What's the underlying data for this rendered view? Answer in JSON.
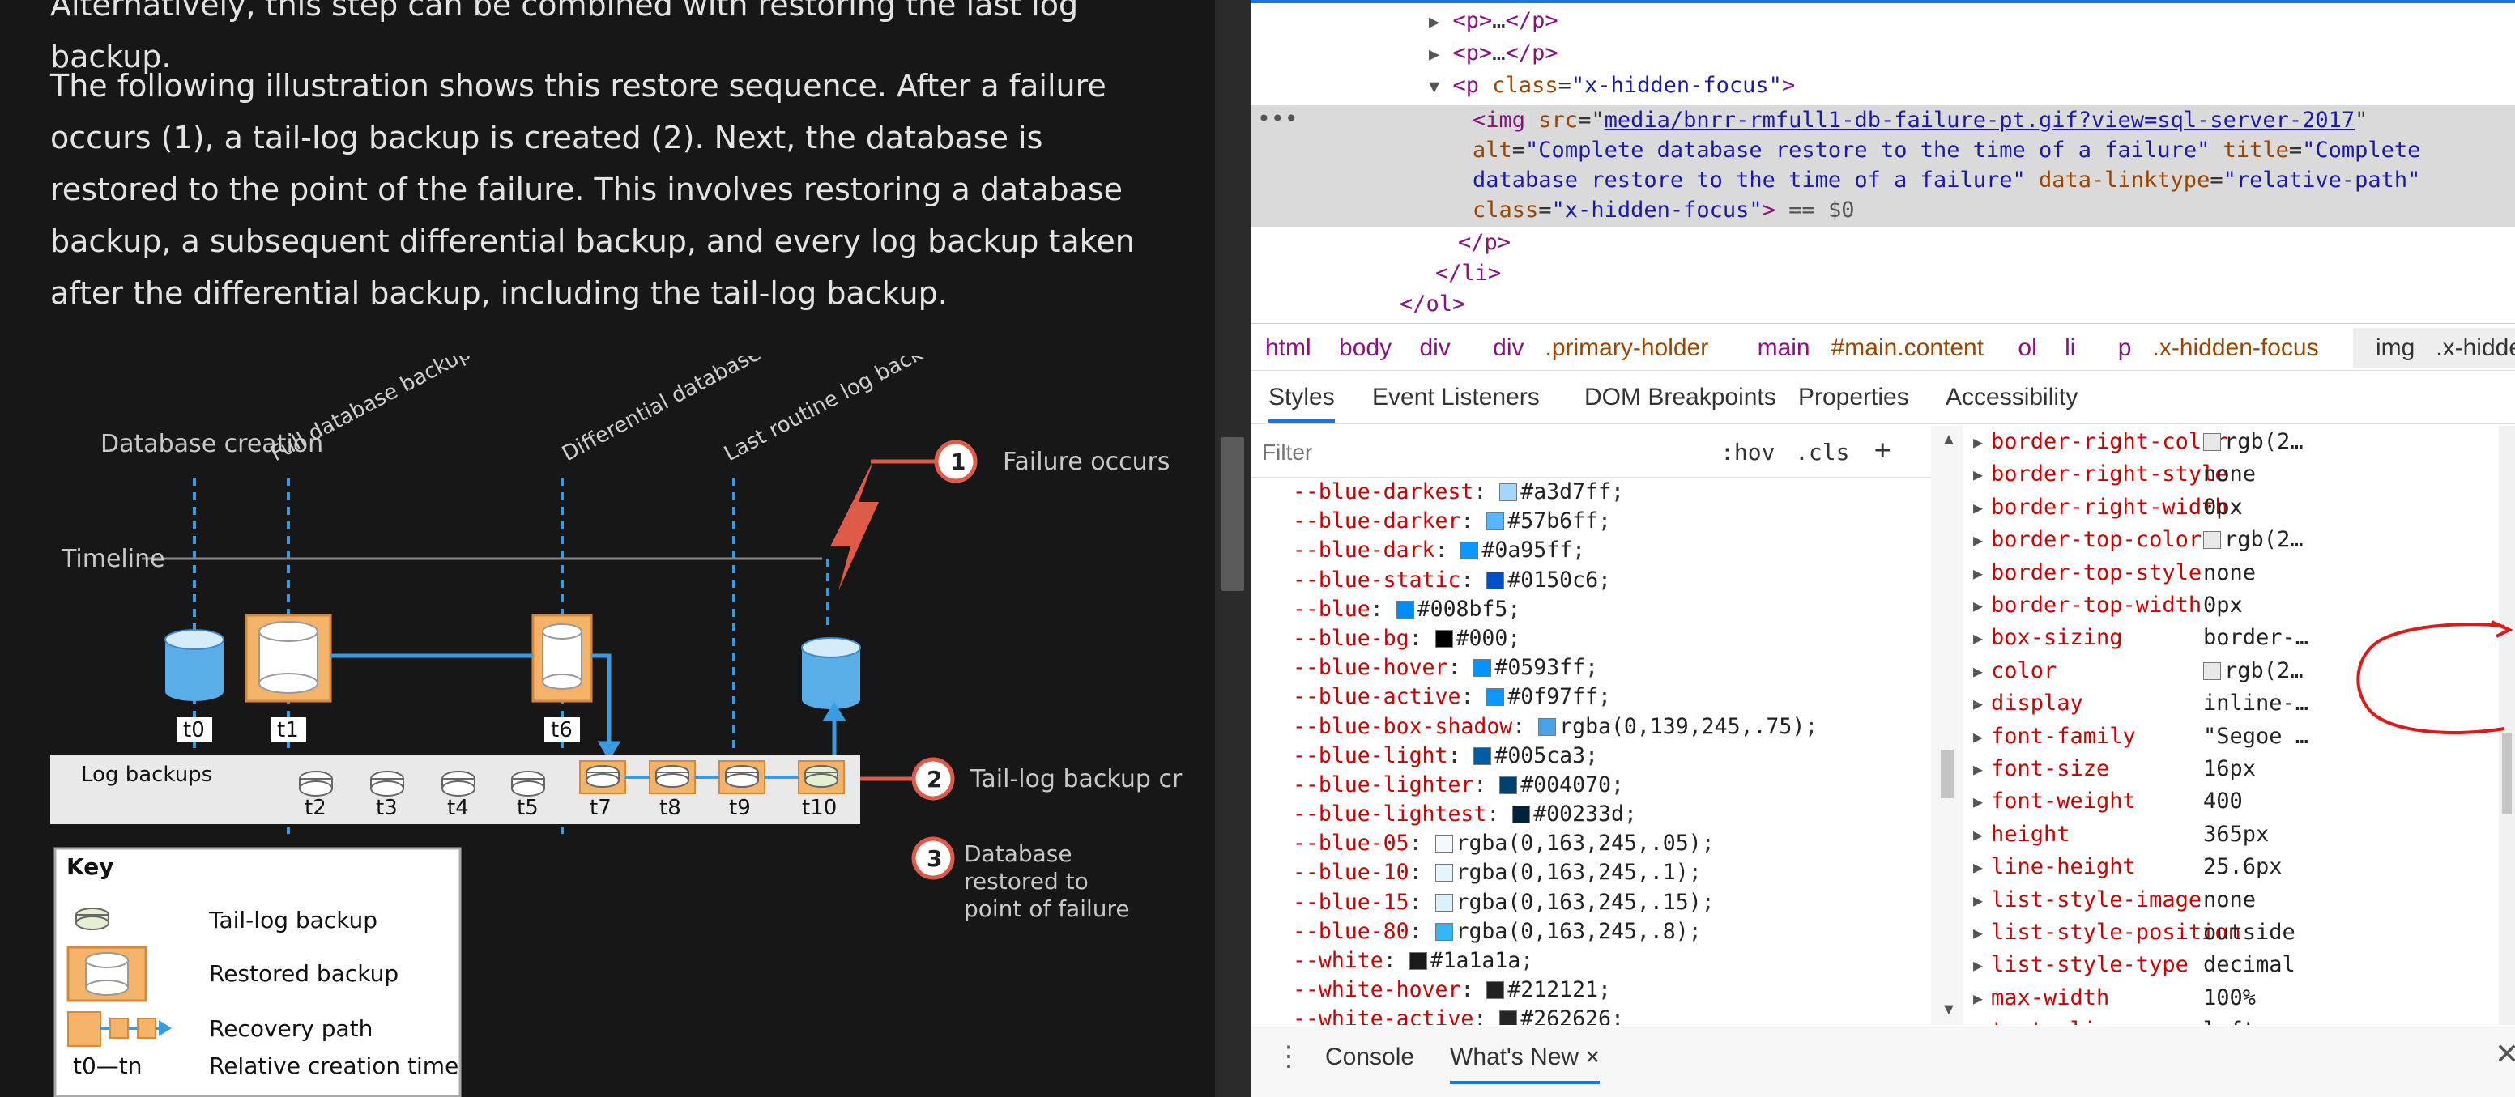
{
  "doc": {
    "para1": "Alternatively, this step can be combined with restoring the last log backup.",
    "para2": "The following illustration shows this restore sequence. After a failure occurs (1), a tail-log backup is created (2). Next, the database is restored to the point of the failure. This involves restoring a database backup, a subsequent differential backup, and every log backup taken after the differential backup, including the tail-log backup.",
    "illustration": {
      "labels": {
        "db_creation": "Database creation",
        "full_backup": "Full database backup",
        "diff_backup": "Differential database backup",
        "last_routine": "Last routine log backup",
        "failure": "Failure occurs",
        "timeline": "Timeline",
        "tail_created": "Tail-log backup created",
        "restored": "Database restored to point of failure",
        "log_backups": "Log backups"
      },
      "markers": [
        "1",
        "2",
        "3"
      ],
      "times_top": [
        "t0",
        "t1",
        "t6"
      ],
      "times_log": [
        "t2",
        "t3",
        "t4",
        "t5",
        "t7",
        "t8",
        "t9",
        "t10"
      ],
      "key": {
        "title": "Key",
        "items": [
          "Tail-log backup",
          "Restored backup",
          "Recovery path",
          "Relative creation time"
        ],
        "time_symbol": "t0—tn"
      }
    }
  },
  "devtools": {
    "elements": {
      "lines": [
        {
          "open": "<p>",
          "ell": "…",
          "close": "</p>"
        },
        {
          "open": "<p>",
          "ell": "…",
          "close": "</p>"
        }
      ],
      "p_open": "<p",
      "p_class_attr": "class",
      "p_class_val": "\"x-hidden-focus\"",
      "img_tag": "<img",
      "src_attr": "src",
      "src_val": "media/bnrr-rmfull1-db-failure-pt.gif?view=sql-server-2017",
      "alt_attr": "alt",
      "alt_val": "\"Complete database restore to the time of a failure\"",
      "title_attr": "title",
      "title_val": "\"Complete database restore to the time of a failure\"",
      "dl_attr": "data-linktype",
      "dl_val": "\"relative-path\"",
      "class_attr": "class",
      "class_val": "\"x-hidden-focus\"",
      "sel_marker": "== $0",
      "close_p": "</p>",
      "close_li": "</li>",
      "close_ol": "</ol>"
    },
    "breadcrumbs": [
      {
        "tag": "html",
        "cls": ""
      },
      {
        "tag": "body",
        "cls": ""
      },
      {
        "tag": "div",
        "cls": ""
      },
      {
        "tag": "div",
        "cls": ".primary-holder"
      },
      {
        "tag": "main",
        "cls": "#main.content"
      },
      {
        "tag": "ol",
        "cls": ""
      },
      {
        "tag": "li",
        "cls": ""
      },
      {
        "tag": "p",
        "cls": ".x-hidden-focus"
      },
      {
        "tag": "img",
        "cls": ".x-hidden-focus"
      }
    ],
    "subtabs": [
      "Styles",
      "Event Listeners",
      "DOM Breakpoints",
      "Properties",
      "Accessibility"
    ],
    "filter_placeholder": "Filter",
    "hov": ":hov",
    "cls": ".cls",
    "plus": "+",
    "css_vars": [
      {
        "name": "--blue-darkest",
        "color": "#a3d7ff",
        "value": "#a3d7ff"
      },
      {
        "name": "--blue-darker",
        "color": "#57b6ff",
        "value": "#57b6ff"
      },
      {
        "name": "--blue-dark",
        "color": "#0a95ff",
        "value": "#0a95ff"
      },
      {
        "name": "--blue-static",
        "color": "#0150c6",
        "value": "#0150c6"
      },
      {
        "name": "--blue",
        "color": "#008bf5",
        "value": "#008bf5"
      },
      {
        "name": "--blue-bg",
        "color": "#000000",
        "value": "#000"
      },
      {
        "name": "--blue-hover",
        "color": "#0593ff",
        "value": "#0593ff"
      },
      {
        "name": "--blue-active",
        "color": "#0f97ff",
        "value": "#0f97ff"
      },
      {
        "name": "--blue-box-shadow",
        "color": "#4aa3e6",
        "value": "rgba(0,139,245,.75)"
      },
      {
        "name": "--blue-light",
        "color": "#005ca3",
        "value": "#005ca3"
      },
      {
        "name": "--blue-lighter",
        "color": "#004070",
        "value": "#004070"
      },
      {
        "name": "--blue-lightest",
        "color": "#00233d",
        "value": "#00233d"
      },
      {
        "name": "--blue-05",
        "color": "#f2fafe",
        "value": "rgba(0,163,245,.05)"
      },
      {
        "name": "--blue-10",
        "color": "#e5f5fe",
        "value": "rgba(0,163,245,.1)"
      },
      {
        "name": "--blue-15",
        "color": "#d9f1fd",
        "value": "rgba(0,163,245,.15)"
      },
      {
        "name": "--blue-80",
        "color": "#33b5f7",
        "value": "rgba(0,163,245,.8)"
      },
      {
        "name": "--white",
        "color": "#1a1a1a",
        "value": "#1a1a1a"
      },
      {
        "name": "--white-hover",
        "color": "#212121",
        "value": "#212121"
      },
      {
        "name": "--white-active",
        "color": "#262626",
        "value": "#262626"
      }
    ],
    "computed": [
      {
        "prop": "border-right-color",
        "value": "rgb(2…",
        "swatch": true
      },
      {
        "prop": "border-right-style",
        "value": "none"
      },
      {
        "prop": "border-right-width",
        "value": "0px"
      },
      {
        "prop": "border-top-color",
        "value": "rgb(2…",
        "swatch": true
      },
      {
        "prop": "border-top-style",
        "value": "none"
      },
      {
        "prop": "border-top-width",
        "value": "0px"
      },
      {
        "prop": "box-sizing",
        "value": "border-…"
      },
      {
        "prop": "color",
        "value": "rgb(2…",
        "swatch": true
      },
      {
        "prop": "display",
        "value": "inline-…"
      },
      {
        "prop": "font-family",
        "value": "\"Segoe …"
      },
      {
        "prop": "font-size",
        "value": "16px"
      },
      {
        "prop": "font-weight",
        "value": "400"
      },
      {
        "prop": "height",
        "value": "365px"
      },
      {
        "prop": "line-height",
        "value": "25.6px"
      },
      {
        "prop": "list-style-image",
        "value": "none"
      },
      {
        "prop": "list-style-position",
        "value": "outside"
      },
      {
        "prop": "list-style-type",
        "value": "decimal"
      },
      {
        "prop": "max-width",
        "value": "100%"
      },
      {
        "prop": "text-align",
        "value": "left"
      }
    ],
    "drawer": {
      "tabs": [
        "Console",
        "What's New"
      ],
      "close": "×"
    }
  }
}
